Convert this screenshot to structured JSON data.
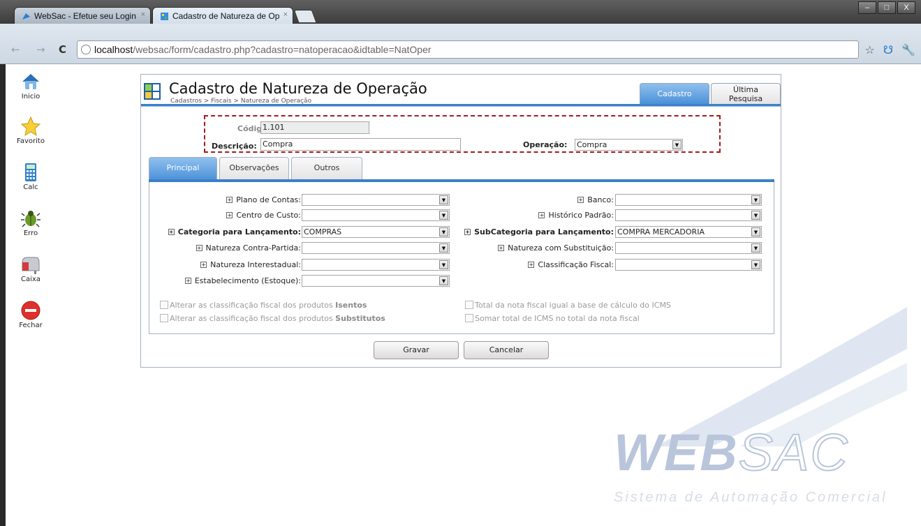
{
  "browser": {
    "tabs": [
      {
        "title": "WebSac - Efetue seu Login",
        "close": "×"
      },
      {
        "title": "Cadastro de Natureza de Op",
        "close": "×"
      }
    ],
    "window_controls": [
      "–",
      "□",
      "X"
    ],
    "url_host": "localhost",
    "url_path": "/websac/form/cadastro.php?cadastro=natoperacao&idtable=NatOper",
    "nav": {
      "back": "←",
      "forward": "→",
      "reload": "C"
    },
    "toolbar_icons": {
      "star": "☆",
      "ext": "☋",
      "wrench": "🔧"
    }
  },
  "sidebar": {
    "items": [
      {
        "label": "Inicio",
        "icon": "home-icon"
      },
      {
        "label": "Favorito",
        "icon": "star-icon"
      },
      {
        "label": "Calc",
        "icon": "calculator-icon"
      },
      {
        "label": "Erro",
        "icon": "bug-icon"
      },
      {
        "label": "Caixa",
        "icon": "mailbox-icon"
      },
      {
        "label": "Fechar",
        "icon": "close-icon"
      }
    ]
  },
  "header": {
    "title": "Cadastro de Natureza de Operação",
    "breadcrumb": "Cadastros > Fiscais > Natureza de Operação",
    "tabs": {
      "cadastro": "Cadastro",
      "ultima_line1": "Última",
      "ultima_line2": "Pesquisa"
    }
  },
  "ident": {
    "codigo_label": "Código:",
    "codigo_value": "1.101",
    "descricao_label": "Descrição:",
    "descricao_value": "Compra",
    "operacao_label": "Operação:",
    "operacao_value": "Compra"
  },
  "form_tabs": [
    "Principal",
    "Observações",
    "Outros"
  ],
  "select_arrow": "▼",
  "plus": "+",
  "fields_left": [
    {
      "label": "Plano de Contas:",
      "value": ""
    },
    {
      "label": "Centro de Custo:",
      "value": ""
    },
    {
      "label": "Categoria para Lançamento:",
      "value": "COMPRAS"
    },
    {
      "label": "Natureza Contra-Partida:",
      "value": ""
    },
    {
      "label": "Natureza Interestadual:",
      "value": ""
    },
    {
      "label": "Estabelecimento (Estoque):",
      "value": ""
    }
  ],
  "fields_right": [
    {
      "label": "Banco:",
      "value": ""
    },
    {
      "label": "Histórico Padrão:",
      "value": ""
    },
    {
      "label": "SubCategoria para Lançamento:",
      "value": "COMPRA MERCADORIA"
    },
    {
      "label": "Natureza com Substituição:",
      "value": ""
    },
    {
      "label": "Classificação Fiscal:",
      "value": ""
    }
  ],
  "checkboxes": {
    "isentos_prefix": "Alterar as classificação fiscal dos produtos",
    "isentos_bold": "Isentos",
    "substitutos_prefix": "Alterar as classificação fiscal dos produtos",
    "substitutos_bold": "Substitutos",
    "total_base": "Total da nota fiscal igual a base de cálculo do ICMS",
    "somar_icms": "Somar total de ICMS no total da nota fiscal"
  },
  "buttons": {
    "gravar": "Gravar",
    "cancelar": "Cancelar"
  },
  "watermark": {
    "logo_web": "WEB",
    "logo_sac": "SAC",
    "tagline": "Sistema de Automação Comercial"
  }
}
